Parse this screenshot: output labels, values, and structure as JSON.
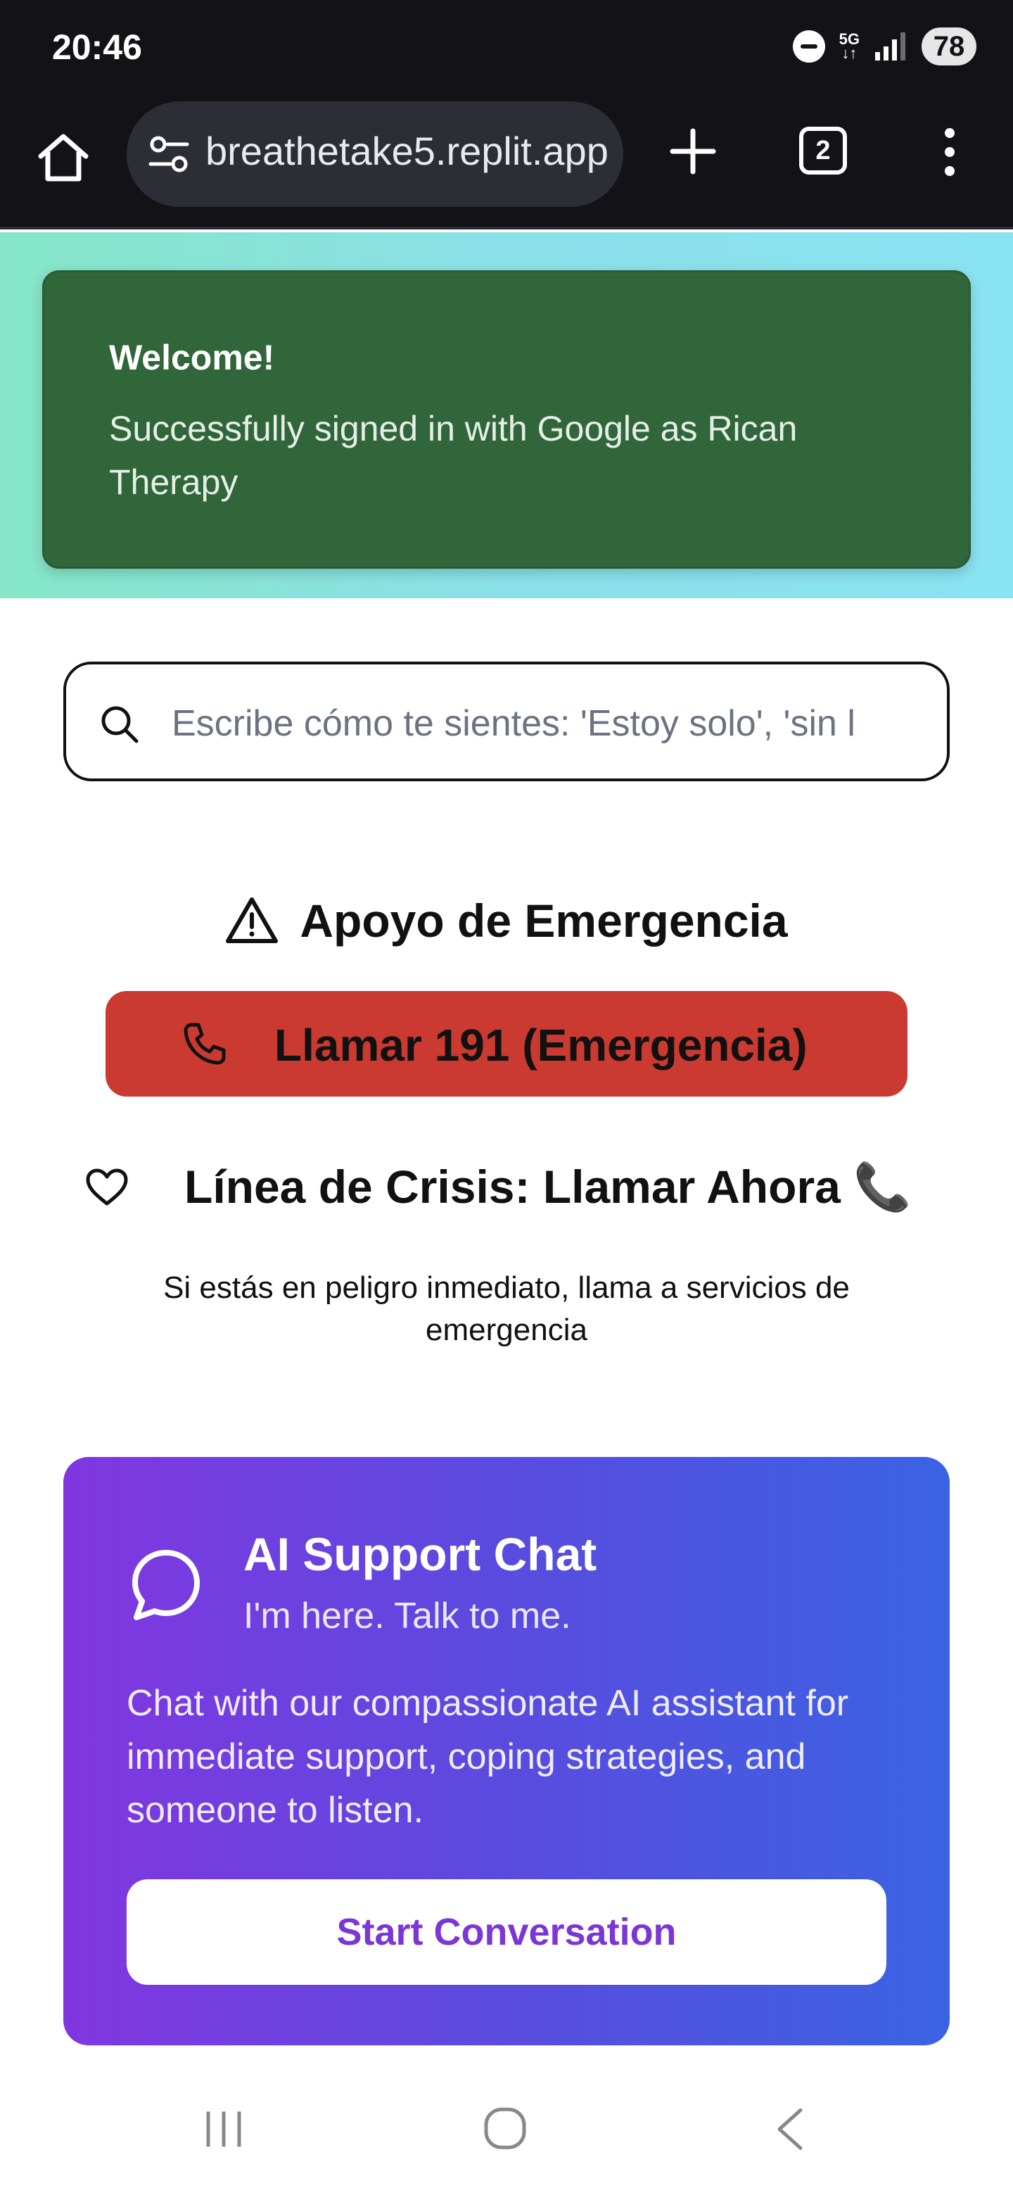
{
  "status_bar": {
    "time": "20:46",
    "network": "5G",
    "battery": "78"
  },
  "browser": {
    "url": "breathetake5.replit.app",
    "tab_count": "2"
  },
  "toast": {
    "title": "Welcome!",
    "message": "Successfully signed in with Google as Rican Therapy"
  },
  "search": {
    "placeholder": "Escribe cómo te sientes: 'Estoy solo', 'sin l"
  },
  "emergency": {
    "title": "Apoyo de Emergencia",
    "call_button": "Llamar 191 (Emergencia)",
    "crisis_line": "Línea de Crisis: Llamar Ahora 📞",
    "note": "Si estás en peligro inmediato, llama a servicios de emergencia"
  },
  "ai_card": {
    "title": "AI Support Chat",
    "subtitle": "I'm here. Talk to me.",
    "body": "Chat with our compassionate AI assistant for immediate support, coping strategies, and someone to listen.",
    "button": "Start Conversation"
  },
  "colors": {
    "status_bar_bg": "#121217",
    "toast_bg": "#31663b",
    "emergency_red": "#cb3a31",
    "card_gradient_start": "#8136df",
    "card_gradient_end": "#3a63e2",
    "button_text_purple": "#7b35d8"
  }
}
